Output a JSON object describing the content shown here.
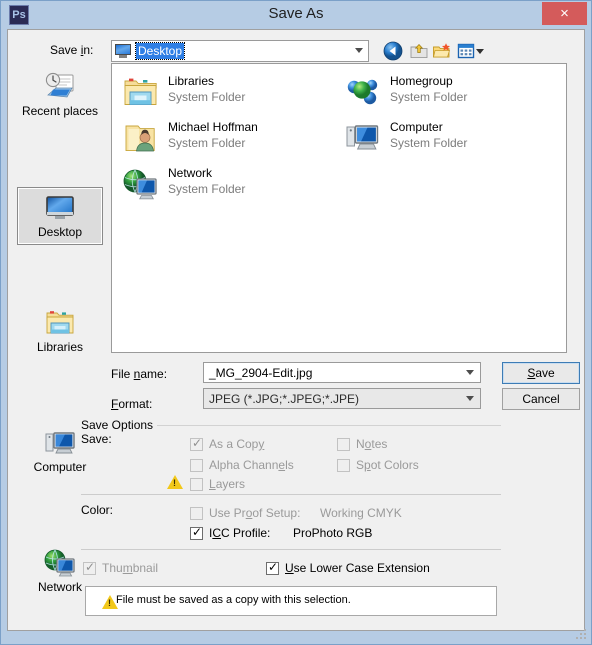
{
  "window": {
    "title": "Save As",
    "app_icon": "photoshop-icon",
    "app_icon_text": "Ps",
    "close_label": "×",
    "frame_color": "#b6cce4",
    "close_color": "#d45b5b"
  },
  "savein": {
    "label": "Save in:",
    "label_accel": "i",
    "value": "Desktop",
    "icon": "desktop-icon",
    "selected": true
  },
  "toolbar": [
    {
      "name": "back-button",
      "icon": "back-arrow-icon",
      "tooltip": "Back"
    },
    {
      "name": "up-button",
      "icon": "up-folder-icon",
      "tooltip": "Up One Level"
    },
    {
      "name": "new-folder-button",
      "icon": "new-folder-icon",
      "tooltip": "Create New Folder"
    },
    {
      "name": "views-button",
      "icon": "views-grid-icon",
      "tooltip": "Views"
    }
  ],
  "places": [
    {
      "label": "Recent places",
      "icon": "recent-places-icon",
      "selected": false
    },
    {
      "label": "Desktop",
      "icon": "desktop-icon",
      "selected": true
    },
    {
      "label": "Libraries",
      "icon": "libraries-folder-icon",
      "selected": false
    },
    {
      "label": "Computer",
      "icon": "computer-icon",
      "selected": false
    },
    {
      "label": "Network",
      "icon": "network-icon",
      "selected": false
    }
  ],
  "files": [
    {
      "name": "Libraries",
      "type": "System Folder",
      "icon": "libraries-folder-icon",
      "col": 0,
      "row": 0
    },
    {
      "name": "Homegroup",
      "type": "System Folder",
      "icon": "homegroup-icon",
      "col": 1,
      "row": 0
    },
    {
      "name": "Michael Hoffman",
      "type": "System Folder",
      "icon": "user-folder-icon",
      "col": 0,
      "row": 1
    },
    {
      "name": "Computer",
      "type": "System Folder",
      "icon": "computer-icon",
      "col": 1,
      "row": 1
    },
    {
      "name": "Network",
      "type": "System Folder",
      "icon": "network-icon",
      "col": 0,
      "row": 2
    }
  ],
  "filename": {
    "label": "File name:",
    "value": "_MG_2904-Edit.jpg"
  },
  "format": {
    "label": "Format:",
    "value": "JPEG (*.JPG;*.JPEG;*.JPE)"
  },
  "buttons": {
    "save": "Save",
    "cancel": "Cancel"
  },
  "save_options": {
    "group_title": "Save Options",
    "save_label": "Save:",
    "color_label": "Color:",
    "checkboxes": [
      {
        "id": "as-a-copy",
        "label": "As a Copy",
        "checked": true,
        "disabled": true,
        "warning": false
      },
      {
        "id": "notes",
        "label": "Notes",
        "checked": false,
        "disabled": true,
        "warning": false
      },
      {
        "id": "alpha-channels",
        "label": "Alpha Channels",
        "checked": false,
        "disabled": true,
        "warning": false
      },
      {
        "id": "spot-colors",
        "label": "Spot Colors",
        "checked": false,
        "disabled": true,
        "warning": false
      },
      {
        "id": "layers",
        "label": "Layers",
        "checked": false,
        "disabled": true,
        "warning": true
      }
    ],
    "color_checkboxes": [
      {
        "id": "use-proof-setup",
        "label": "Use Proof Setup:",
        "value": "Working CMYK",
        "checked": false,
        "disabled": true
      },
      {
        "id": "icc-profile",
        "label": "ICC Profile:",
        "value": "ProPhoto RGB",
        "checked": true,
        "disabled": false
      }
    ],
    "footer_checkboxes": [
      {
        "id": "thumbnail",
        "label": "Thumbnail",
        "checked": true,
        "disabled": true
      },
      {
        "id": "use-lower-case-extension",
        "label": "Use Lower Case Extension",
        "checked": true,
        "disabled": false
      }
    ]
  },
  "message": {
    "text": "File must be saved as a copy with this selection.",
    "icon": "warning-icon"
  }
}
